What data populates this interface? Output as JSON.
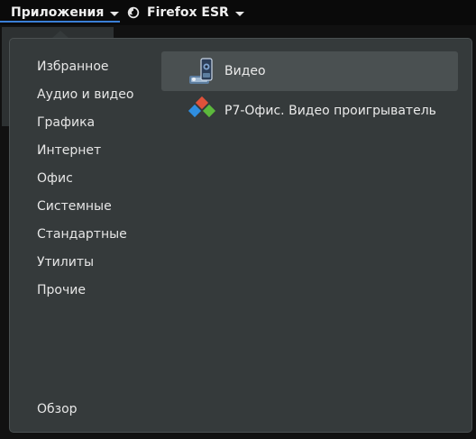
{
  "topbar": {
    "apps_label": "Приложения",
    "browser_label": "Firefox ESR"
  },
  "menu": {
    "categories": [
      "Избранное",
      "Аудио и видео",
      "Графика",
      "Интернет",
      "Офис",
      "Системные",
      "Стандартные",
      "Утилиты",
      "Прочие"
    ],
    "overview_label": "Обзор",
    "apps": [
      {
        "label": "Видео",
        "icon": "video-player-icon",
        "selected": true
      },
      {
        "label": "Р7-Офис. Видео проигрыватель",
        "icon": "r7-office-video-icon",
        "selected": false
      }
    ]
  },
  "colors": {
    "menu_bg": "#353a3b",
    "selected_bg": "#4a5051",
    "accent": "#3a7fd6",
    "topbar_bg": "#0a0a0a"
  }
}
